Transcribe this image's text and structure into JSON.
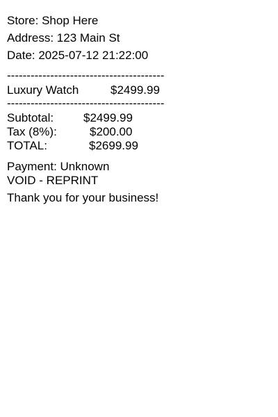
{
  "receipt": {
    "store": "Store: Shop Here",
    "address": "Address: 123 Main St",
    "date": "Date: 2025-07-12 21:22:00",
    "divider": "----------------------------------------",
    "item": {
      "name": "Luxury Watch",
      "price": "$2499.99"
    },
    "subtotal": {
      "label": "Subtotal:",
      "value": "$2499.99"
    },
    "tax": {
      "label": "Tax (8%):",
      "value": "$200.00"
    },
    "total": {
      "label": "TOTAL:",
      "value": "$2699.99"
    },
    "payment": "Payment: Unknown",
    "status": "VOID - REPRINT",
    "thanks": "Thank you for your business!"
  }
}
